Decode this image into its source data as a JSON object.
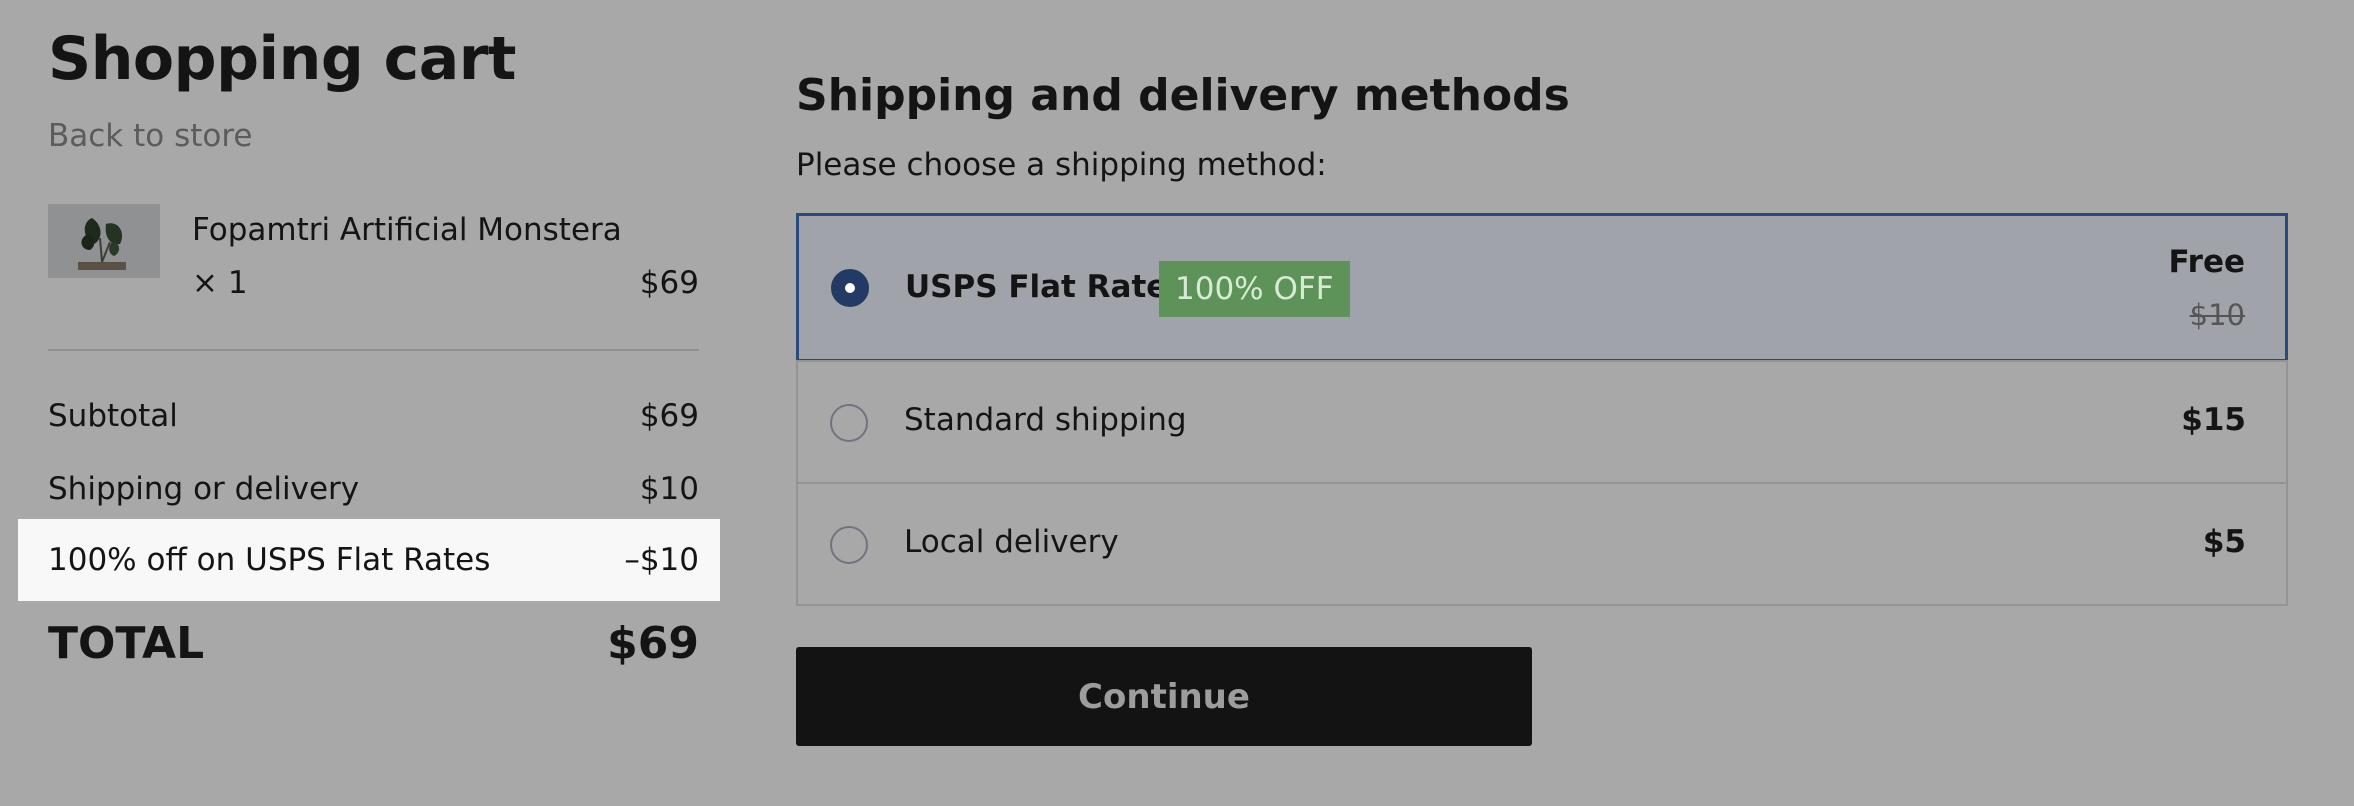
{
  "cart": {
    "title": "Shopping cart",
    "back_link": "Back to store",
    "item": {
      "name": "Fopamtri Artificial Monstera",
      "quantity": "× 1",
      "price": "$69"
    },
    "summary": {
      "subtotal_label": "Subtotal",
      "subtotal_value": "$69",
      "shipping_label": "Shipping or delivery",
      "shipping_value": "$10",
      "discount_label": "100% off on USPS Flat Rates",
      "discount_value": "–$10",
      "total_label": "TOTAL",
      "total_value": "$69"
    }
  },
  "shipping": {
    "title": "Shipping and delivery methods",
    "instruction": "Please choose a shipping method:",
    "options": [
      {
        "label": "USPS Flat Rates",
        "badge": "100% OFF",
        "price": "Free",
        "old_price": "$10",
        "selected": true
      },
      {
        "label": "Standard shipping",
        "price": "$15",
        "selected": false
      },
      {
        "label": "Local delivery",
        "price": "$5",
        "selected": false
      }
    ],
    "continue_label": "Continue"
  },
  "colors": {
    "background": "#a8a8a8",
    "selected_border": "#2b4a7c",
    "badge_bg": "#5d9258",
    "button_bg": "#131313"
  }
}
